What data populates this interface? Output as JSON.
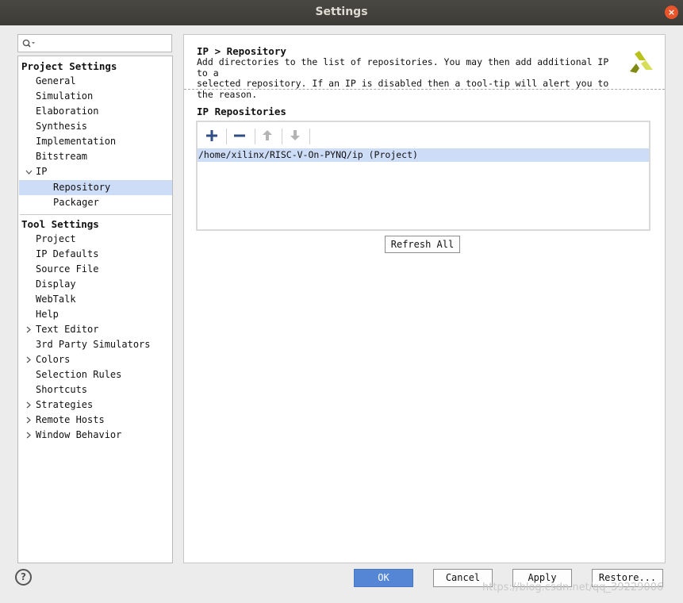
{
  "window": {
    "title": "Settings",
    "close_glyph": "×"
  },
  "search": {
    "icon": "search-icon",
    "placeholder": ""
  },
  "sidebar": {
    "project_settings": {
      "heading": "Project Settings",
      "items": [
        {
          "label": "General"
        },
        {
          "label": "Simulation"
        },
        {
          "label": "Elaboration"
        },
        {
          "label": "Synthesis"
        },
        {
          "label": "Implementation"
        },
        {
          "label": "Bitstream"
        },
        {
          "label": "IP",
          "expanded": true
        },
        {
          "label": "Repository",
          "selected": true
        },
        {
          "label": "Packager"
        }
      ]
    },
    "tool_settings": {
      "heading": "Tool Settings",
      "items": [
        {
          "label": "Project"
        },
        {
          "label": "IP Defaults"
        },
        {
          "label": "Source File"
        },
        {
          "label": "Display"
        },
        {
          "label": "WebTalk"
        },
        {
          "label": "Help"
        },
        {
          "label": "Text Editor",
          "collapsed": true
        },
        {
          "label": "3rd Party Simulators"
        },
        {
          "label": "Colors",
          "collapsed": true
        },
        {
          "label": "Selection Rules"
        },
        {
          "label": "Shortcuts"
        },
        {
          "label": "Strategies",
          "collapsed": true
        },
        {
          "label": "Remote Hosts",
          "collapsed": true
        },
        {
          "label": "Window Behavior",
          "collapsed": true
        }
      ]
    }
  },
  "main": {
    "breadcrumb": "IP > Repository",
    "description_line1": "Add directories to the list of repositories. You may then add additional IP to a",
    "description_line2": "selected repository. If an IP is disabled then a tool-tip will alert you to the reason.",
    "logo": "xilinx-logo",
    "repositories": {
      "heading": "IP Repositories",
      "toolbar": [
        "add-icon",
        "remove-icon",
        "move-up-icon",
        "move-down-icon"
      ],
      "rows": [
        "/home/xilinx/RISC-V-On-PYNQ/ip (Project)"
      ]
    },
    "refresh_label": "Refresh All"
  },
  "footer": {
    "help_glyph": "?",
    "ok": "OK",
    "cancel": "Cancel",
    "apply": "Apply",
    "restore": "Restore...",
    "watermark": "https://blog.csdn.net/qq_39229006"
  },
  "colors": {
    "accent": "#5586d6",
    "selection": "#cddcf7",
    "titlebar": "#3c3b37",
    "close": "#e9542a"
  }
}
